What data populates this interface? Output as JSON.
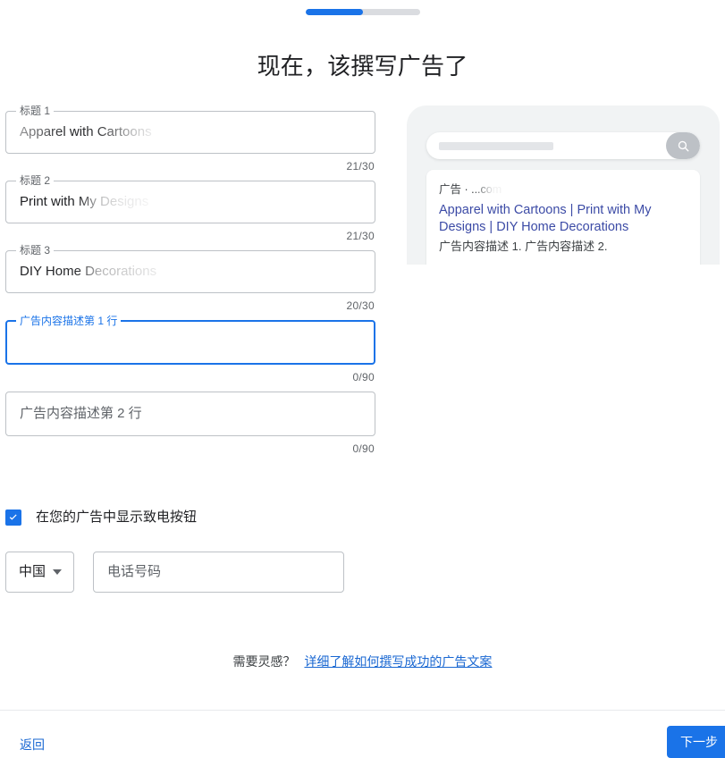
{
  "progress": {
    "percent": 50,
    "label": "50"
  },
  "page": {
    "title": "现在，该撰写广告了"
  },
  "form": {
    "fields": [
      {
        "label": "标题 1",
        "value": "Apparel with Cartoons",
        "placeholder": "标题 1",
        "counter": "21/30",
        "focused": false
      },
      {
        "label": "标题 2",
        "value": "Print with My Designs",
        "placeholder": "标题 2",
        "counter": "21/30",
        "focused": false
      },
      {
        "label": "标题 3",
        "value": "DIY Home Decorations",
        "placeholder": "标题 3",
        "counter": "20/30",
        "focused": false
      },
      {
        "label": "广告内容描述第 1 行",
        "value": "",
        "placeholder": "广告内容描述第 1 行",
        "counter": "0/90",
        "focused": true
      },
      {
        "label": "",
        "value": "",
        "placeholder": "广告内容描述第 2 行",
        "counter": "0/90",
        "focused": false
      }
    ],
    "call_checkbox": {
      "label": "在您的广告中显示致电按钮",
      "checked": true,
      "icon": "check-icon"
    },
    "country": {
      "value": "中国",
      "icon": "chevron-down-icon"
    },
    "phone": {
      "value": "",
      "placeholder": "电话号码"
    }
  },
  "preview": {
    "search_icon": "search-icon",
    "search_placeholder": "",
    "ad": {
      "domain_line": "广告 ·            ...com",
      "headline": "Apparel with Cartoons | Print with My Designs | DIY Home Decorations",
      "description": "广告内容描述 1. 广告内容描述 2."
    }
  },
  "inspiration": {
    "prompt": "需要灵感？",
    "link": "详细了解如何撰写成功的广告文案"
  },
  "footer": {
    "back": "返回",
    "next": "下一步"
  },
  "colors": {
    "accent": "#1a73e8",
    "link": "#1967d2",
    "headline": "#3c4ba6",
    "border": "#bdc1c6",
    "track": "#dadce0"
  }
}
